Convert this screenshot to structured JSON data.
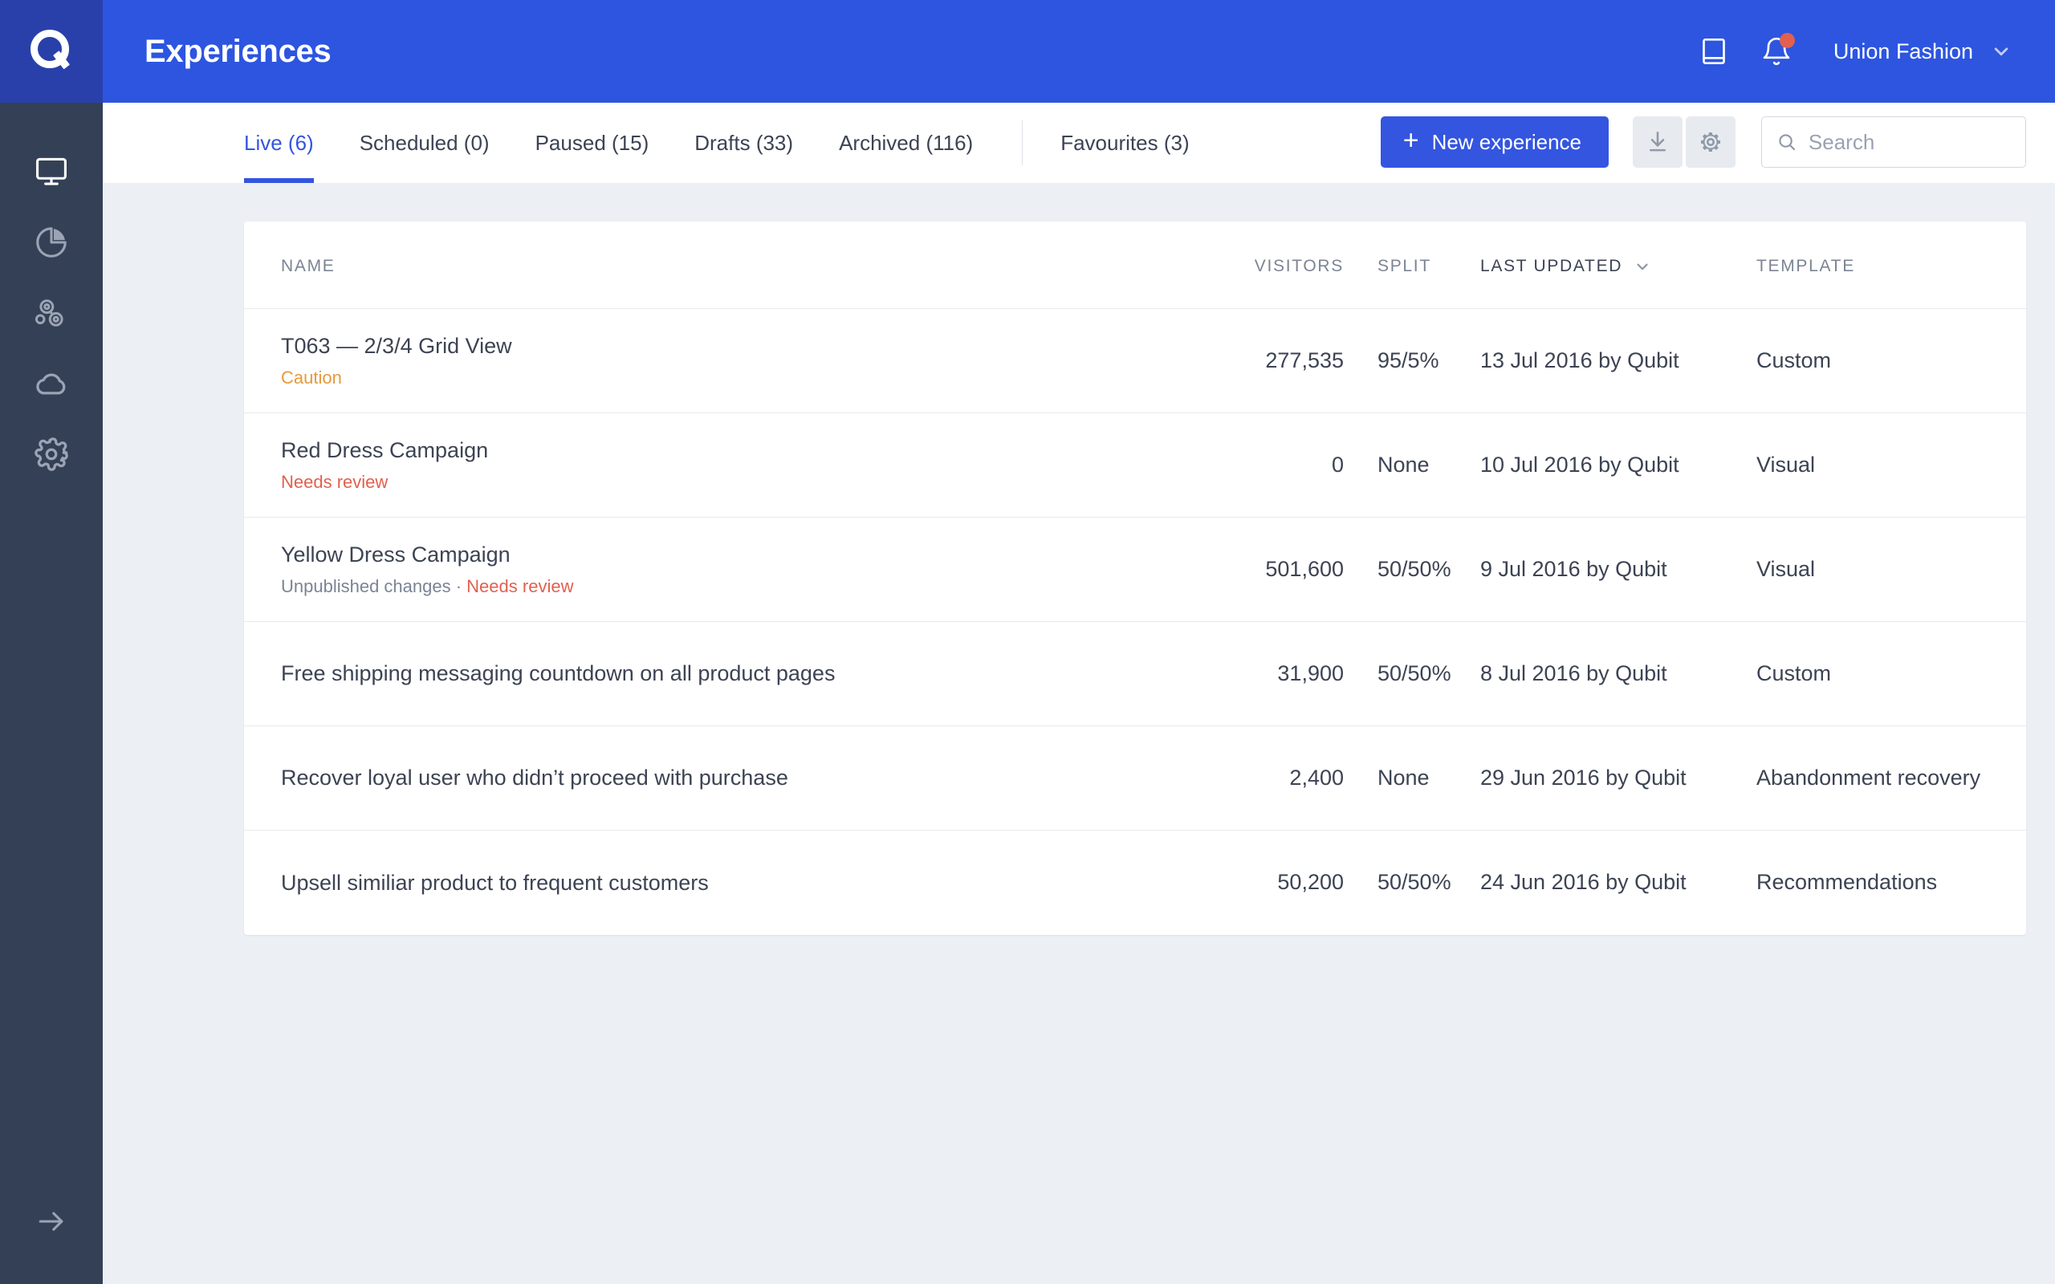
{
  "brand": {
    "logo_letter": "Q",
    "logo_bg": "#2940ab",
    "header_bg": "#2d55e0",
    "sidebar_bg": "#344055",
    "accent": "#3355e0",
    "page_bg": "#eceff3",
    "caution_color": "#e59a3c",
    "danger_color": "#e1604f"
  },
  "header": {
    "title": "Experiences",
    "book_icon": "book-icon",
    "bell_icon": "bell-icon",
    "has_notification": true,
    "account_name": "Union Fashion",
    "chevron_icon": "chevron-down-icon"
  },
  "sidebar": {
    "items": [
      {
        "icon": "monitor-icon",
        "name": "experiences",
        "active": true
      },
      {
        "icon": "pie-chart-icon",
        "name": "analytics",
        "active": false
      },
      {
        "icon": "segments-icon",
        "name": "segments",
        "active": false
      },
      {
        "icon": "cloud-icon",
        "name": "data",
        "active": false
      },
      {
        "icon": "gear-icon",
        "name": "settings",
        "active": false
      }
    ],
    "expand_icon": "arrow-right-icon"
  },
  "toolbar": {
    "tabs": [
      {
        "label": "Live (6)",
        "key": "live",
        "active": true
      },
      {
        "label": "Scheduled (0)",
        "key": "scheduled",
        "active": false
      },
      {
        "label": "Paused (15)",
        "key": "paused",
        "active": false
      },
      {
        "label": "Drafts (33)",
        "key": "drafts",
        "active": false
      },
      {
        "label": "Archived (116)",
        "key": "archived",
        "active": false
      }
    ],
    "favourites_tab": {
      "label": "Favourites (3)",
      "key": "favourites",
      "active": false
    },
    "new_experience_label": "New experience",
    "plus_glyph": "+",
    "download_icon": "download-icon",
    "settings_icon": "gear-icon",
    "search": {
      "placeholder": "Search",
      "value": "",
      "icon": "search-icon"
    }
  },
  "table": {
    "columns": {
      "name": "Name",
      "visitors": "Visitors",
      "split": "Split",
      "last_updated": "Last updated",
      "template": "Template"
    },
    "sort_column": "last_updated",
    "sort_icon": "chevron-down-icon",
    "rows": [
      {
        "name": "T063 — 2/3/4 Grid View",
        "status_muted": "",
        "status_separator": "",
        "status_flag": "Caution",
        "status_flag_type": "caution",
        "visitors": "277,535",
        "split": "95/5%",
        "last_updated": "13 Jul 2016 by Qubit",
        "template": "Custom"
      },
      {
        "name": "Red Dress Campaign",
        "status_muted": "",
        "status_separator": "",
        "status_flag": "Needs review",
        "status_flag_type": "review",
        "visitors": "0",
        "split": "None",
        "last_updated": "10 Jul 2016 by Qubit",
        "template": "Visual"
      },
      {
        "name": "Yellow Dress Campaign",
        "status_muted": "Unpublished changes",
        "status_separator": " · ",
        "status_flag": "Needs review",
        "status_flag_type": "review",
        "visitors": "501,600",
        "split": "50/50%",
        "last_updated": "9 Jul 2016 by Qubit",
        "template": "Visual"
      },
      {
        "name": "Free shipping messaging countdown on all product pages",
        "status_muted": "",
        "status_separator": "",
        "status_flag": "",
        "status_flag_type": "",
        "visitors": "31,900",
        "split": "50/50%",
        "last_updated": "8 Jul 2016 by Qubit",
        "template": "Custom"
      },
      {
        "name": "Recover loyal user who didn’t proceed with purchase",
        "status_muted": "",
        "status_separator": "",
        "status_flag": "",
        "status_flag_type": "",
        "visitors": "2,400",
        "split": "None",
        "last_updated": "29 Jun 2016 by Qubit",
        "template": "Abandonment recovery"
      },
      {
        "name": "Upsell similiar product to frequent customers",
        "status_muted": "",
        "status_separator": "",
        "status_flag": "",
        "status_flag_type": "",
        "visitors": "50,200",
        "split": "50/50%",
        "last_updated": "24 Jun 2016 by Qubit",
        "template": "Recommendations"
      }
    ]
  }
}
